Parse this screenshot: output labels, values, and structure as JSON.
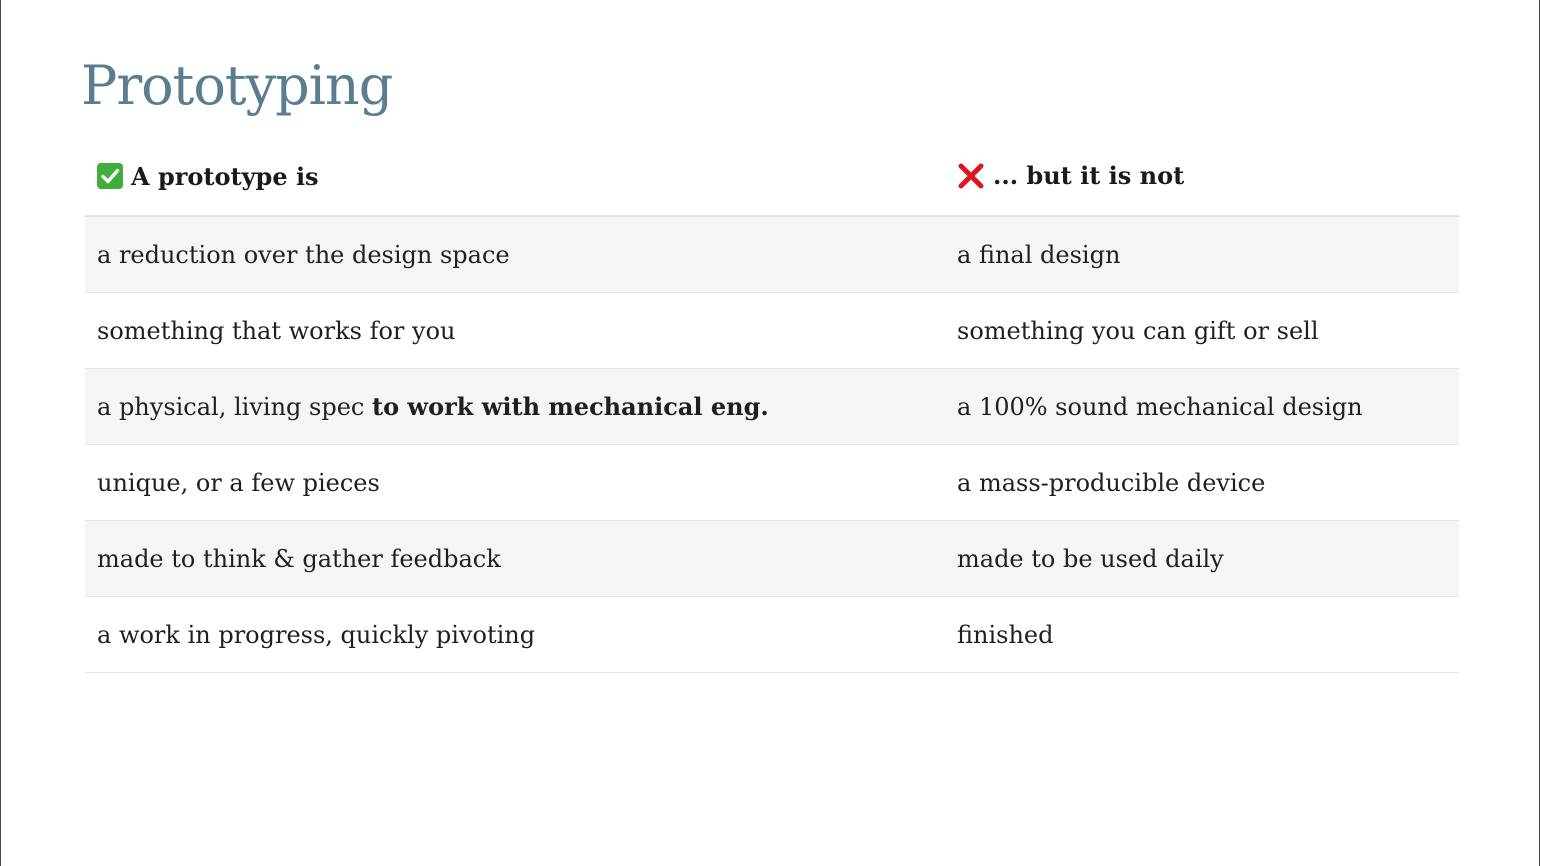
{
  "page_title": "Prototyping",
  "table": {
    "headers": {
      "left": {
        "icon": "check-mark-icon",
        "label": "A prototype is"
      },
      "right": {
        "icon": "cross-mark-icon",
        "label": "... but it is not"
      }
    },
    "rows": [
      {
        "left": "a reduction over the design space",
        "left_bold": "",
        "right": "a final design"
      },
      {
        "left": "something that works for you",
        "left_bold": "",
        "right": "something you can gift or sell"
      },
      {
        "left": "a physical, living spec ",
        "left_bold": "to work with mechanical eng.",
        "right": "a 100% sound mechanical design"
      },
      {
        "left": "unique, or a few pieces",
        "left_bold": "",
        "right": "a mass-producible device"
      },
      {
        "left": "made to think & gather feedback",
        "left_bold": "",
        "right": "made to be used daily"
      },
      {
        "left": "a work in progress, quickly pivoting",
        "left_bold": "",
        "right": "finished"
      }
    ]
  },
  "colors": {
    "title": "#5b7e8f",
    "check_icon": "#3fae3a",
    "cross_icon": "#e0141c",
    "row_stripe": "#f5f5f5"
  }
}
